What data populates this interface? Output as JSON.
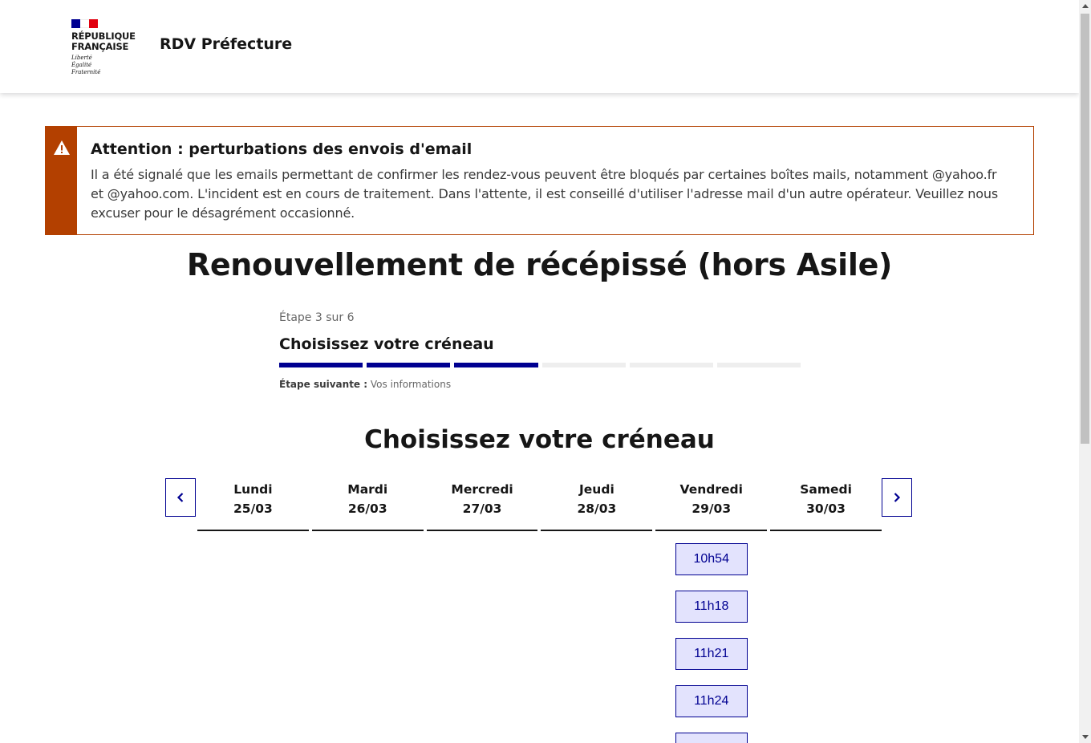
{
  "header": {
    "republic_line1": "République",
    "republic_line2": "Française",
    "motto_1": "Liberté",
    "motto_2": "Égalité",
    "motto_3": "Fraternité",
    "service_name": "RDV Préfecture",
    "flag_colors": [
      "#000091",
      "#ffffff",
      "#e1000f"
    ]
  },
  "alert": {
    "icon": "warning-icon",
    "title": "Attention : perturbations des envois d'email",
    "text": "Il a été signalé que les emails permettant de confirmer les rendez-vous peuvent être bloqués par certaines boîtes mails, notamment @yahoo.fr et @yahoo.com. L'incident est en cours de traitement. Dans l'attente, il est conseillé d'utiliser l'adresse mail d'un autre opérateur. Veuillez nous excuser pour le désagrément occasionné.",
    "color": "#b34000"
  },
  "page_title": "Renouvellement de récépissé (hors Asile)",
  "stepper": {
    "state": "Étape 3 sur 6",
    "title": "Choisissez votre créneau",
    "current_step": 3,
    "total_steps": 6,
    "next_label": "Étape suivante :",
    "next_value": "Vos informations",
    "active_color": "#000091"
  },
  "calendar": {
    "title": "Choisissez votre créneau",
    "prev_icon": "chevron-left-icon",
    "next_icon": "chevron-right-icon",
    "days": [
      {
        "name": "Lundi",
        "date": "25/03",
        "slots": []
      },
      {
        "name": "Mardi",
        "date": "26/03",
        "slots": []
      },
      {
        "name": "Mercredi",
        "date": "27/03",
        "slots": []
      },
      {
        "name": "Jeudi",
        "date": "28/03",
        "slots": []
      },
      {
        "name": "Vendredi",
        "date": "29/03",
        "slots": [
          "10h54",
          "11h18",
          "11h21",
          "11h24"
        ]
      },
      {
        "name": "Samedi",
        "date": "30/03",
        "slots": []
      }
    ]
  }
}
